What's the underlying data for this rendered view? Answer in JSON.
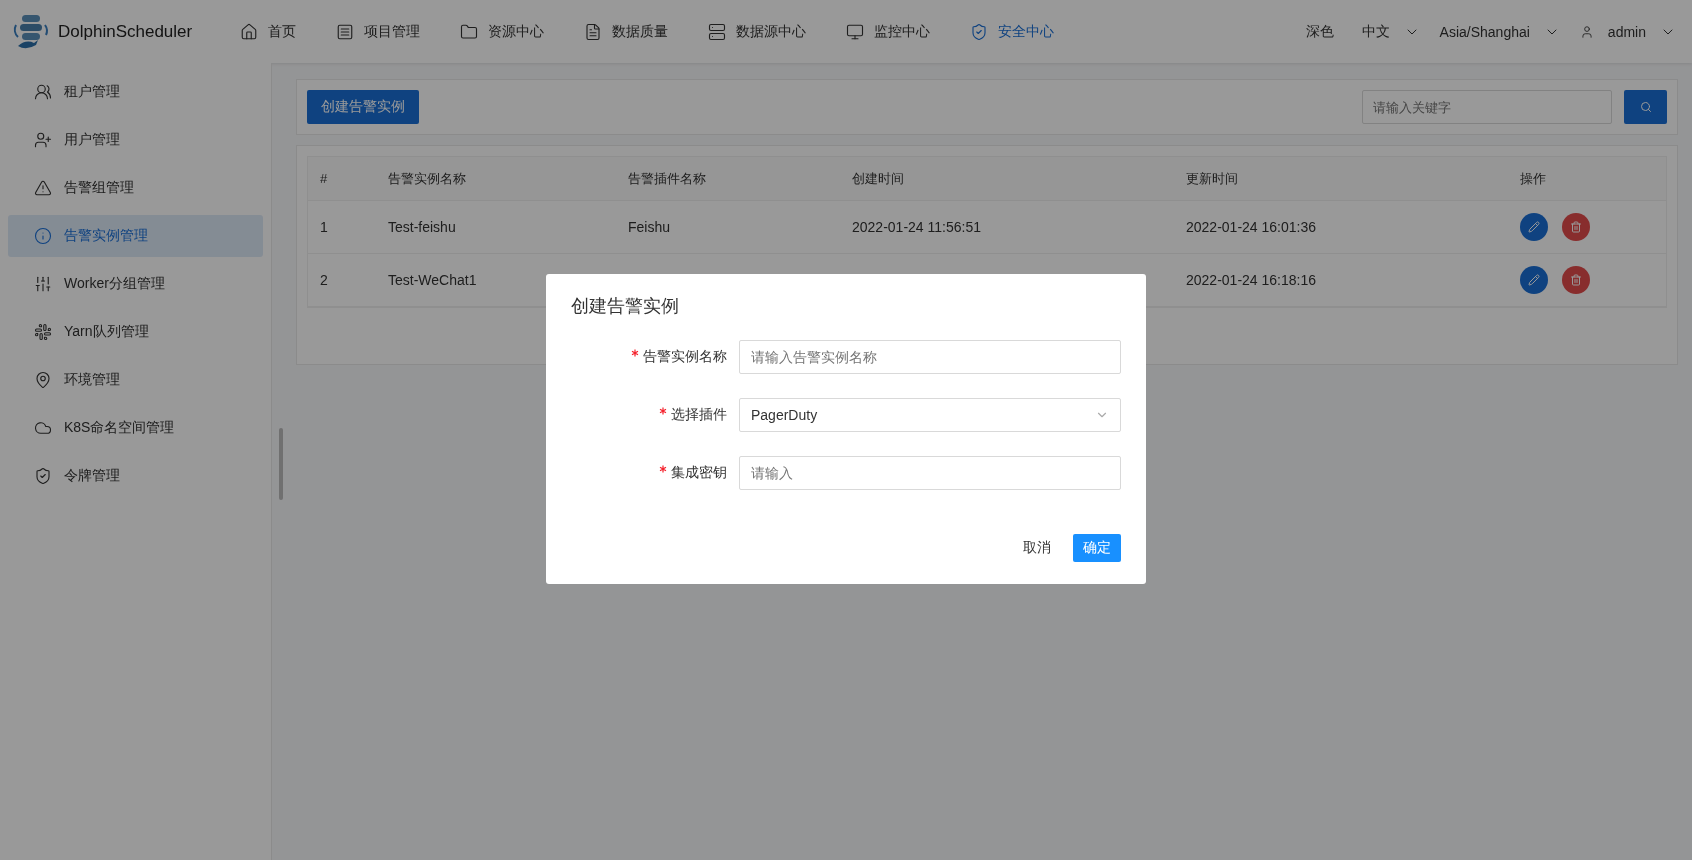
{
  "header": {
    "logo_text": "DolphinScheduler",
    "nav": [
      {
        "label": "首页",
        "selected": false
      },
      {
        "label": "项目管理",
        "selected": false
      },
      {
        "label": "资源中心",
        "selected": false
      },
      {
        "label": "数据质量",
        "selected": false
      },
      {
        "label": "数据源中心",
        "selected": false
      },
      {
        "label": "监控中心",
        "selected": false
      },
      {
        "label": "安全中心",
        "selected": true
      }
    ],
    "theme": "深色",
    "language": "中文",
    "timezone": "Asia/Shanghai",
    "user": "admin"
  },
  "sidebar": {
    "items": [
      {
        "label": "租户管理",
        "selected": false
      },
      {
        "label": "用户管理",
        "selected": false
      },
      {
        "label": "告警组管理",
        "selected": false
      },
      {
        "label": "告警实例管理",
        "selected": true
      },
      {
        "label": "Worker分组管理",
        "selected": false
      },
      {
        "label": "Yarn队列管理",
        "selected": false
      },
      {
        "label": "环境管理",
        "selected": false
      },
      {
        "label": "K8S命名空间管理",
        "selected": false
      },
      {
        "label": "令牌管理",
        "selected": false
      }
    ]
  },
  "toolbar": {
    "create_button": "创建告警实例",
    "search": {
      "placeholder": "请输入关键字"
    }
  },
  "table": {
    "columns": [
      "#",
      "告警实例名称",
      "告警插件名称",
      "创建时间",
      "更新时间",
      "操作"
    ],
    "rows": [
      {
        "index": "1",
        "name": "Test-feishu",
        "plugin": "Feishu",
        "created": "2022-01-24 11:56:51",
        "updated": "2022-01-24 16:01:36"
      },
      {
        "index": "2",
        "name": "Test-WeChat1",
        "updated": "2022-01-24 16:18:16"
      }
    ]
  },
  "modal": {
    "title": "创建告警实例",
    "fields": [
      {
        "kind": "input",
        "label": "告警实例名称",
        "required": true,
        "placeholder": "请输入告警实例名称"
      },
      {
        "kind": "select",
        "label": "选择插件",
        "required": true,
        "value": "PagerDuty"
      },
      {
        "kind": "input",
        "label": "集成密钥",
        "required": true,
        "placeholder": "请输入"
      }
    ],
    "cancel": "取消",
    "confirm": "确定"
  }
}
